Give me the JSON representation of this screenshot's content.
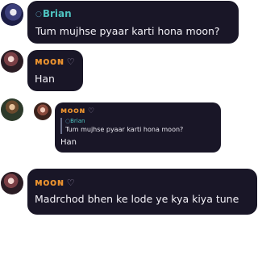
{
  "messages": [
    {
      "author_tag": "○",
      "author": "Brian",
      "text": "Tum mujhse pyaar karti hona moon?"
    },
    {
      "author": "ᴍᴏᴏɴ",
      "heart": "♡",
      "text": "Han"
    },
    {
      "author": "ᴍᴏᴏɴ",
      "heart": "♡",
      "reply": {
        "author_tag": "○",
        "author": "Brian",
        "text": "Tum mujhse pyaar karti hona moon?"
      },
      "text": "Han"
    },
    {
      "author": "ᴍᴏᴏɴ",
      "heart": "♡",
      "text": "Madrchod bhen ke lode ye kya kiya tune"
    }
  ]
}
